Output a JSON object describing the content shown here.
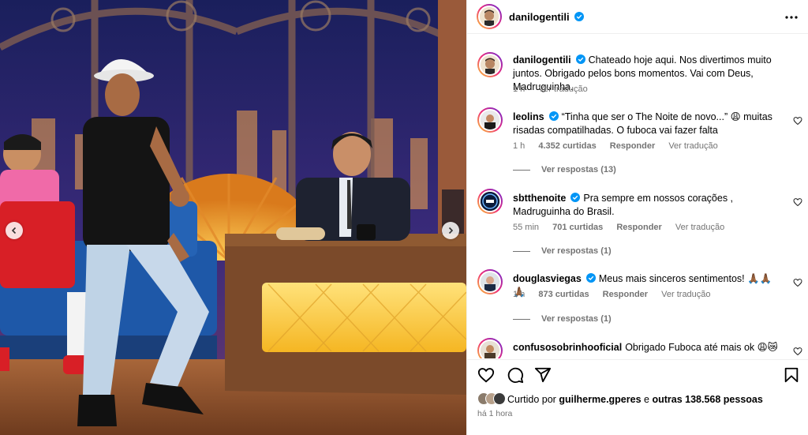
{
  "post": {
    "author": "danilogentili",
    "more_icon": "more-horizontal-icon"
  },
  "caption": {
    "username": "danilogentili",
    "text": "Chateado hoje aqui. Nos divertimos muito juntos. Obrigado pelos bons momentos. Vai com Deus, Madruguinha.",
    "time": "1 h",
    "translate": "Ver tradução"
  },
  "comments": [
    {
      "username": "leolins",
      "verified": true,
      "text": "“Tinha que ser o The Noite de novo...” 😩 muitas risadas compatilhadas. O fuboca vai fazer falta",
      "time": "1 h",
      "likes": "4.352 curtidas",
      "reply": "Responder",
      "translate": "Ver tradução",
      "replies": "Ver respostas (13)"
    },
    {
      "username": "sbtthenoite",
      "verified": true,
      "text": "Pra sempre em nossos corações , Madruguinha do Brasil.",
      "time": "55 min",
      "likes": "701 curtidas",
      "reply": "Responder",
      "translate": "Ver tradução",
      "replies": "Ver respostas (1)"
    },
    {
      "username": "douglasviegas",
      "verified": true,
      "text": "Meus mais sinceros sentimentos! 🙏🏾🙏🏾🙏🏾",
      "time": "1 h",
      "likes": "873 curtidas",
      "reply": "Responder",
      "translate": "Ver tradução",
      "replies": "Ver respostas (1)"
    },
    {
      "username": "confusosobrinhooficial",
      "verified": false,
      "text": "Obrigado Fuboca até mais ok 😩😿"
    }
  ],
  "actions": {
    "like_icon": "heart-icon",
    "comment_icon": "comment-icon",
    "share_icon": "send-icon",
    "save_icon": "bookmark-icon"
  },
  "likes": {
    "prefix": "Curtido por",
    "user": "guilherme.gperes",
    "middle": "e",
    "others": "outras 138.568 pessoas"
  },
  "timestamp": "há 1 hora",
  "colors": {
    "verified": "#0095f6",
    "secondary_text": "#737373",
    "border": "#efefef"
  }
}
